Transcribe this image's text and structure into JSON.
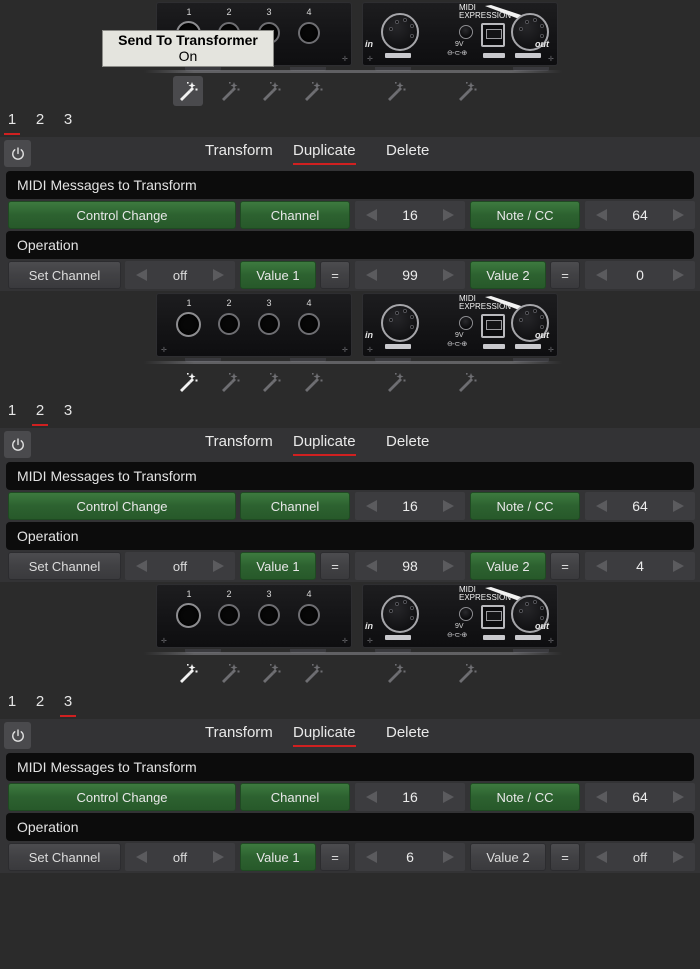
{
  "app": {
    "background_color": "#2b2b2b",
    "panel_color": "#333335",
    "accent_color": "#d02020",
    "active_green": "#2d6230"
  },
  "tooltip": {
    "title": "Send To Transformer",
    "value": "On"
  },
  "device": {
    "jack_labels": [
      "1",
      "2",
      "3",
      "4"
    ],
    "brand_line1": "MIDI",
    "brand_line2": "EXPRESSION",
    "port_in_label": "in",
    "port_out_label": "out",
    "power_label": "9V",
    "power_symbol": "⊖-⊂-⊕"
  },
  "wand_toolbar": {
    "icon_name": "magic-wand-icon",
    "count": 6,
    "active_index": 0
  },
  "panels": [
    {
      "tabs": [
        {
          "label": "1",
          "active": true
        },
        {
          "label": "2",
          "active": false
        },
        {
          "label": "3",
          "active": false
        }
      ],
      "power_icon": "power-icon",
      "nav": [
        {
          "label": "Transform",
          "active": false
        },
        {
          "label": "Duplicate",
          "active": true
        },
        {
          "label": "Delete",
          "active": false
        }
      ],
      "messages_section_title": "MIDI Messages to Transform",
      "message_type": {
        "label": "Control Change",
        "active": true
      },
      "channel": {
        "label": "Channel",
        "active": true,
        "value": "16"
      },
      "note_cc": {
        "label": "Note / CC",
        "active": true,
        "value": "64"
      },
      "operation_section_title": "Operation",
      "set_channel": {
        "label": "Set Channel",
        "active": false,
        "value": "off"
      },
      "value1": {
        "label": "Value 1",
        "active": true,
        "eq": "=",
        "value": "99"
      },
      "value2": {
        "label": "Value 2",
        "active": true,
        "eq": "=",
        "value": "0"
      }
    },
    {
      "tabs": [
        {
          "label": "1",
          "active": false
        },
        {
          "label": "2",
          "active": true
        },
        {
          "label": "3",
          "active": false
        }
      ],
      "power_icon": "power-icon",
      "nav": [
        {
          "label": "Transform",
          "active": false
        },
        {
          "label": "Duplicate",
          "active": true
        },
        {
          "label": "Delete",
          "active": false
        }
      ],
      "messages_section_title": "MIDI Messages to Transform",
      "message_type": {
        "label": "Control Change",
        "active": true
      },
      "channel": {
        "label": "Channel",
        "active": true,
        "value": "16"
      },
      "note_cc": {
        "label": "Note / CC",
        "active": true,
        "value": "64"
      },
      "operation_section_title": "Operation",
      "set_channel": {
        "label": "Set Channel",
        "active": false,
        "value": "off"
      },
      "value1": {
        "label": "Value 1",
        "active": true,
        "eq": "=",
        "value": "98"
      },
      "value2": {
        "label": "Value 2",
        "active": true,
        "eq": "=",
        "value": "4"
      }
    },
    {
      "tabs": [
        {
          "label": "1",
          "active": false
        },
        {
          "label": "2",
          "active": false
        },
        {
          "label": "3",
          "active": true
        }
      ],
      "power_icon": "power-icon",
      "nav": [
        {
          "label": "Transform",
          "active": false
        },
        {
          "label": "Duplicate",
          "active": true
        },
        {
          "label": "Delete",
          "active": false
        }
      ],
      "messages_section_title": "MIDI Messages to Transform",
      "message_type": {
        "label": "Control Change",
        "active": true
      },
      "channel": {
        "label": "Channel",
        "active": true,
        "value": "16"
      },
      "note_cc": {
        "label": "Note / CC",
        "active": true,
        "value": "64"
      },
      "operation_section_title": "Operation",
      "set_channel": {
        "label": "Set Channel",
        "active": false,
        "value": "off"
      },
      "value1": {
        "label": "Value 1",
        "active": true,
        "eq": "=",
        "value": "6"
      },
      "value2": {
        "label": "Value 2",
        "active": false,
        "eq": "=",
        "value": "off"
      }
    }
  ]
}
